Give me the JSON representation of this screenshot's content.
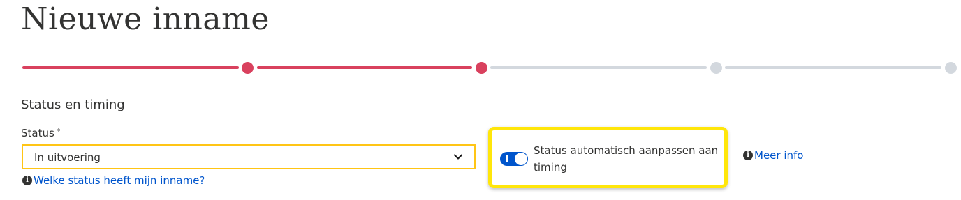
{
  "page": {
    "title": "Nieuwe inname"
  },
  "stepper": {
    "steps": [
      {
        "state": "done"
      },
      {
        "state": "done"
      },
      {
        "state": "todo"
      },
      {
        "state": "todo"
      }
    ],
    "colors": {
      "done": "#d9415e",
      "todo": "#d3d8de"
    }
  },
  "section": {
    "title": "Status en timing"
  },
  "status_field": {
    "label": "Status",
    "required_mark": "*",
    "value": "In uitvoering",
    "icon": "chevron-down-icon",
    "border_color": "#ffc515"
  },
  "help": {
    "icon": "info-icon",
    "icon_glyph": "i",
    "link_text": "Welke status heeft mijn inname?"
  },
  "auto_status": {
    "toggle_on": true,
    "label": "Status automatisch aanpassen aan timing",
    "highlight_color": "#ffe60a"
  },
  "more_info": {
    "icon": "info-icon",
    "icon_glyph": "i",
    "link_text": "Meer info"
  }
}
